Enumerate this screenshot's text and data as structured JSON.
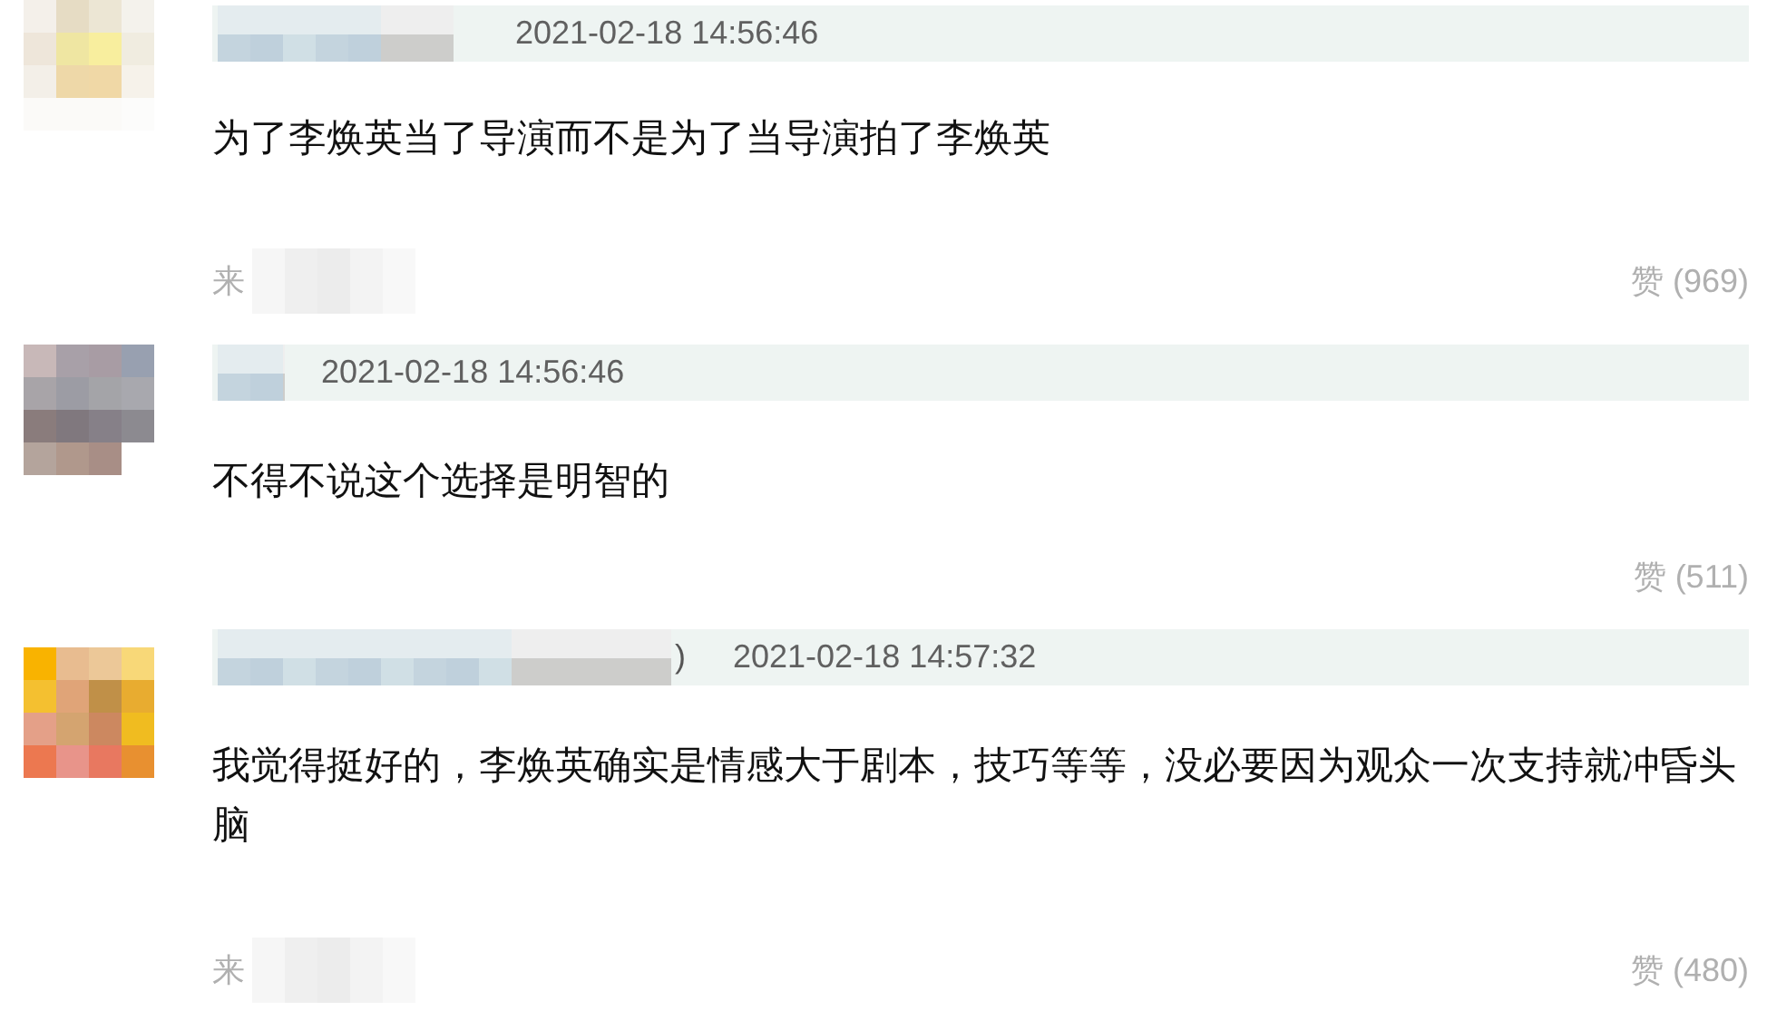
{
  "comments": [
    {
      "time": "2021-02-18 14:56:46",
      "text": "为了李焕英当了导演而不是为了当导演拍了李焕英",
      "source": "来",
      "likes": "赞 (969)"
    },
    {
      "time": "2021-02-18 14:56:46",
      "text": "不得不说这个选择是明智的",
      "likes": "赞 (511)"
    },
    {
      "name_tail": ")",
      "time": "2021-02-18 14:57:32",
      "text": "我觉得挺好的，李焕英确实是情感大于剧本，技巧等等，没必要因为观众一次支持就冲昏头脑",
      "source": "来",
      "likes": "赞 (480)"
    }
  ]
}
